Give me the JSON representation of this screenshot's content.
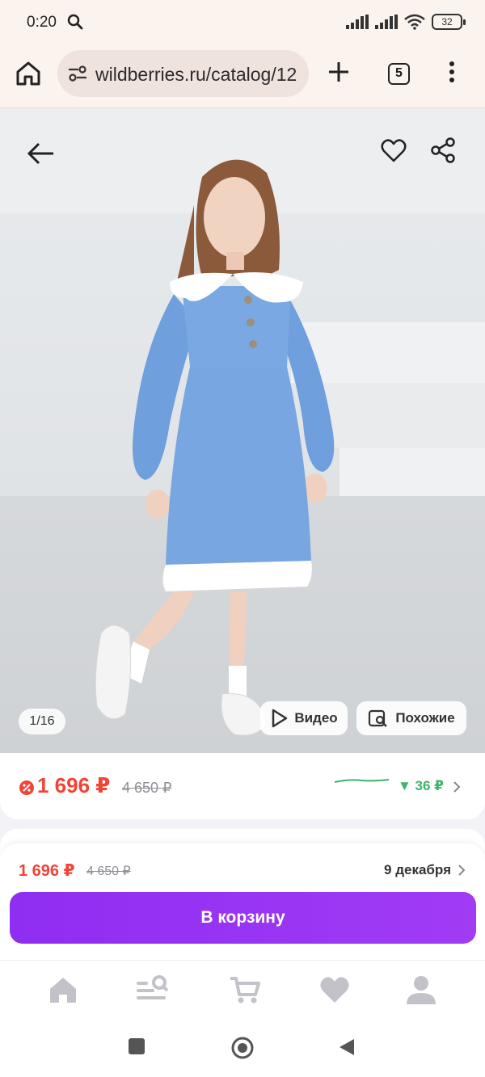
{
  "status": {
    "time": "0:20",
    "battery": "32",
    "icons": [
      "search-icon",
      "signal-icon",
      "signal-icon",
      "wifi-icon",
      "battery-icon"
    ]
  },
  "browser": {
    "url": "wildberries.ru/catalog/12",
    "tab_count": "5"
  },
  "product": {
    "image_counter": "1/16",
    "video_label": "Видео",
    "similar_label": "Похожие"
  },
  "price": {
    "current": "1 696 ₽",
    "old": "4 650 ₽",
    "trend": "▼ 36 ₽"
  },
  "buy_panel": {
    "price": "1 696 ₽",
    "old_price": "4 650 ₽",
    "delivery_date": "9 декабря",
    "cart_button": "В корзину"
  },
  "nav": {
    "items": [
      "home-icon",
      "catalog-search-icon",
      "cart-icon",
      "favorites-icon",
      "profile-icon"
    ]
  },
  "colors": {
    "accent": "#9b36f3",
    "price_red": "#f24336",
    "trend_green": "#3bb56b"
  }
}
